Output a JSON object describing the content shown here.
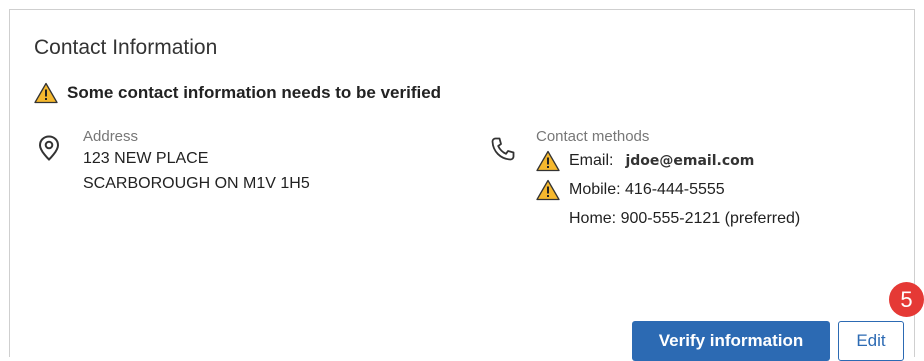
{
  "card": {
    "title": "Contact Information",
    "warning_text": "Some contact information needs to be verified",
    "address": {
      "label": "Address",
      "line1": "123 NEW PLACE",
      "line2": "SCARBOROUGH ON M1V 1H5",
      "icon": "location-pin-icon"
    },
    "contact_methods": {
      "label": "Contact methods",
      "icon": "phone-icon",
      "email_label": "Email:",
      "email_value": "jdoe@email.com",
      "mobile": "Mobile: 416-444-5555",
      "home": "Home: 900-555-2121 (preferred)"
    },
    "actions": {
      "verify_label": "Verify information",
      "edit_label": "Edit"
    }
  },
  "step_badge": "5",
  "colors": {
    "primary": "#2c6ab3",
    "warning_fill": "#f5b82e",
    "badge": "#e53935"
  }
}
